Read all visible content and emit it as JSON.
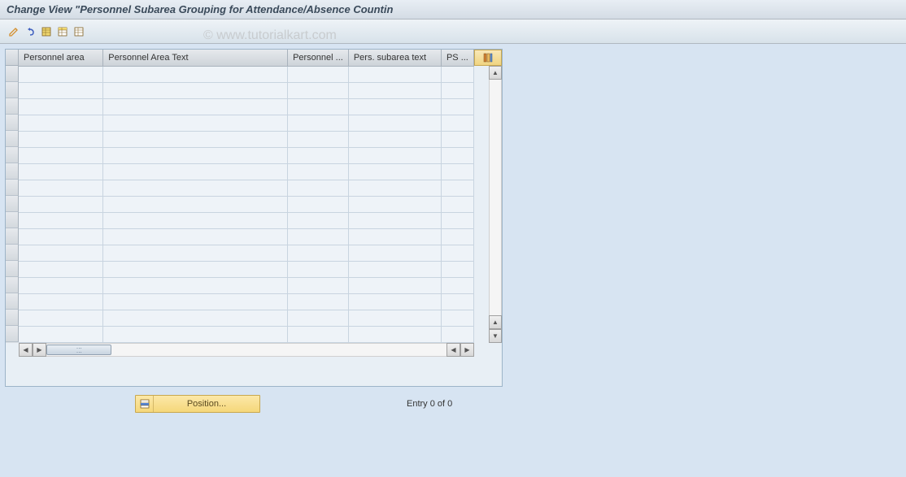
{
  "title": "Change View \"Personnel Subarea Grouping for Attendance/Absence Countin",
  "watermark": "© www.tutorialkart.com",
  "toolbar": {
    "icons": [
      "change-icon",
      "undo-icon",
      "select-all-icon",
      "select-block-icon",
      "deselect-icon"
    ]
  },
  "table": {
    "columns": [
      {
        "label": "Personnel area"
      },
      {
        "label": "Personnel Area Text"
      },
      {
        "label": "Personnel ..."
      },
      {
        "label": "Pers. subarea text"
      },
      {
        "label": "PS ..."
      }
    ],
    "row_count": 17
  },
  "footer": {
    "position_label": "Position...",
    "entry_text": "Entry 0 of 0"
  }
}
